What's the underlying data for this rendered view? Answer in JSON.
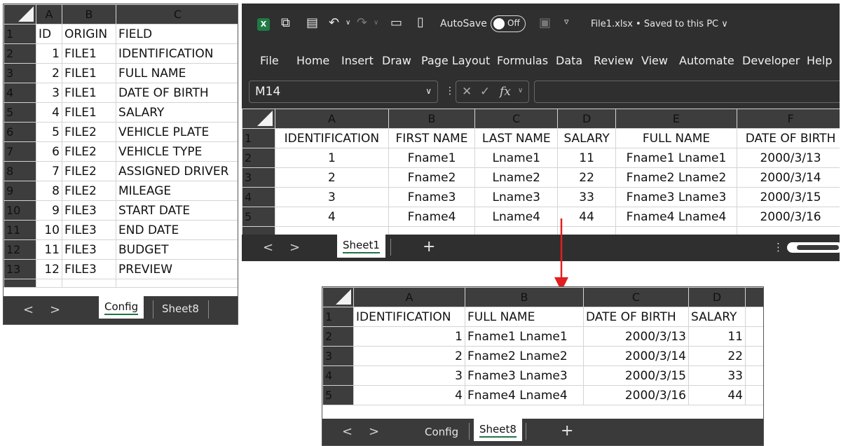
{
  "config_panel": {
    "columns": [
      "A",
      "B",
      "C"
    ],
    "header_row": [
      "ID",
      "ORIGIN",
      "FIELD"
    ],
    "rows": [
      {
        "n": "2",
        "id": "1",
        "origin": "FILE1",
        "field": "IDENTIFICATION"
      },
      {
        "n": "3",
        "id": "2",
        "origin": "FILE1",
        "field": "FULL NAME"
      },
      {
        "n": "4",
        "id": "3",
        "origin": "FILE1",
        "field": "DATE OF BIRTH"
      },
      {
        "n": "5",
        "id": "4",
        "origin": "FILE1",
        "field": "SALARY"
      },
      {
        "n": "6",
        "id": "5",
        "origin": "FILE2",
        "field": "VEHICLE PLATE"
      },
      {
        "n": "7",
        "id": "6",
        "origin": "FILE2",
        "field": "VEHICLE TYPE"
      },
      {
        "n": "8",
        "id": "7",
        "origin": "FILE2",
        "field": "ASSIGNED DRIVER"
      },
      {
        "n": "9",
        "id": "8",
        "origin": "FILE2",
        "field": "MILEAGE"
      },
      {
        "n": "10",
        "id": "9",
        "origin": "FILE3",
        "field": "START DATE"
      },
      {
        "n": "11",
        "id": "10",
        "origin": "FILE3",
        "field": "END DATE"
      },
      {
        "n": "12",
        "id": "11",
        "origin": "FILE3",
        "field": "BUDGET"
      },
      {
        "n": "13",
        "id": "12",
        "origin": "FILE3",
        "field": "PREVIEW"
      }
    ],
    "tabs": {
      "config": "Config",
      "sheet8": "Sheet8"
    },
    "nav": {
      "prev": "<",
      "next": ">"
    }
  },
  "excel_window": {
    "app_icon_text": "X",
    "autosave_label": "AutoSave",
    "autosave_state": "Off",
    "file_title": "File1.xlsx • Saved to this PC ∨",
    "menu": [
      "File",
      "Home",
      "Insert",
      "Draw",
      "Page Layout",
      "Formulas",
      "Data",
      "Review",
      "View",
      "Automate",
      "Developer",
      "Help"
    ],
    "name_box": "M14",
    "fx_label": "fx",
    "columns": [
      "A",
      "B",
      "C",
      "D",
      "E",
      "F"
    ],
    "header_row": [
      "IDENTIFICATION",
      "FIRST NAME",
      "LAST NAME",
      "SALARY",
      "FULL NAME",
      "DATE OF BIRTH"
    ],
    "rows": [
      {
        "n": "2",
        "cells": [
          "1",
          "Fname1",
          "Lname1",
          "11",
          "Fname1 Lname1",
          "2000/3/13"
        ]
      },
      {
        "n": "3",
        "cells": [
          "2",
          "Fname2",
          "Lname2",
          "22",
          "Fname2 Lname2",
          "2000/3/14"
        ]
      },
      {
        "n": "4",
        "cells": [
          "3",
          "Fname3",
          "Lname3",
          "33",
          "Fname3 Lname3",
          "2000/3/15"
        ]
      },
      {
        "n": "5",
        "cells": [
          "4",
          "Fname4",
          "Lname4",
          "44",
          "Fname4 Lname4",
          "2000/3/16"
        ]
      }
    ],
    "tabs": {
      "sheet1": "Sheet1",
      "add": "+"
    },
    "nav": {
      "prev": "<",
      "next": ">"
    }
  },
  "result_panel": {
    "columns": [
      "A",
      "B",
      "C",
      "D"
    ],
    "header_row": [
      "IDENTIFICATION",
      "FULL NAME",
      "DATE OF BIRTH",
      "SALARY"
    ],
    "rows": [
      {
        "n": "2",
        "cells": [
          "1",
          "Fname1 Lname1",
          "2000/3/13",
          "11"
        ]
      },
      {
        "n": "3",
        "cells": [
          "2",
          "Fname2 Lname2",
          "2000/3/14",
          "22"
        ]
      },
      {
        "n": "4",
        "cells": [
          "3",
          "Fname3 Lname3",
          "2000/3/15",
          "33"
        ]
      },
      {
        "n": "5",
        "cells": [
          "4",
          "Fname4 Lname4",
          "2000/3/16",
          "44"
        ]
      }
    ],
    "tabs": {
      "config": "Config",
      "sheet8": "Sheet8",
      "add": "+"
    },
    "nav": {
      "prev": "<",
      "next": ">"
    }
  },
  "colors": {
    "arrow": "#e02020",
    "excel_green": "#217346",
    "header_bg": "#3d3d3d"
  }
}
